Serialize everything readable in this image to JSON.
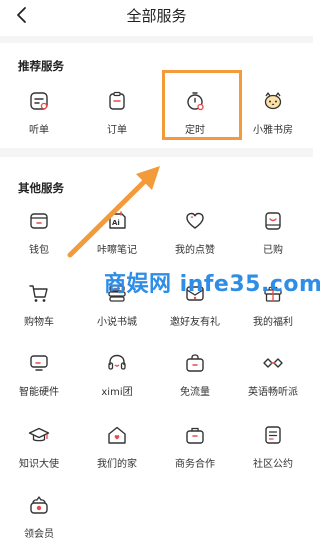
{
  "header": {
    "title": "全部服务"
  },
  "sections": {
    "recommended": {
      "title": "推荐服务"
    },
    "other": {
      "title": "其他服务"
    }
  },
  "recommended_items": [
    {
      "label": "听单",
      "icon": "playlist-icon"
    },
    {
      "label": "订单",
      "icon": "clipboard-icon"
    },
    {
      "label": "定时",
      "icon": "timer-icon"
    },
    {
      "label": "小雅书房",
      "icon": "cat-icon"
    }
  ],
  "other_items": [
    {
      "label": "钱包",
      "icon": "wallet-icon"
    },
    {
      "label": "咔嚓笔记",
      "icon": "note-icon"
    },
    {
      "label": "我的点赞",
      "icon": "heart-icon"
    },
    {
      "label": "已购",
      "icon": "purchased-icon"
    },
    {
      "label": "购物车",
      "icon": "cart-icon"
    },
    {
      "label": "小说书城",
      "icon": "books-icon"
    },
    {
      "label": "邀好友有礼",
      "icon": "invite-icon"
    },
    {
      "label": "我的福利",
      "icon": "gift-icon"
    },
    {
      "label": "智能硬件",
      "icon": "tv-icon"
    },
    {
      "label": "ximi团",
      "icon": "headset-icon"
    },
    {
      "label": "免流量",
      "icon": "bag-icon"
    },
    {
      "label": "英语畅听派",
      "icon": "link-icon"
    },
    {
      "label": "知识大使",
      "icon": "graduation-icon"
    },
    {
      "label": "我们的家",
      "icon": "home-icon"
    },
    {
      "label": "商务合作",
      "icon": "briefcase-icon"
    },
    {
      "label": "社区公约",
      "icon": "document-icon"
    },
    {
      "label": "领会员",
      "icon": "vip-icon"
    }
  ],
  "watermark": {
    "text": "商娱网 infe35.com"
  },
  "colors": {
    "highlight": "#f39a3a",
    "arrow": "#f39a3a",
    "watermark": "#2e8de6"
  }
}
